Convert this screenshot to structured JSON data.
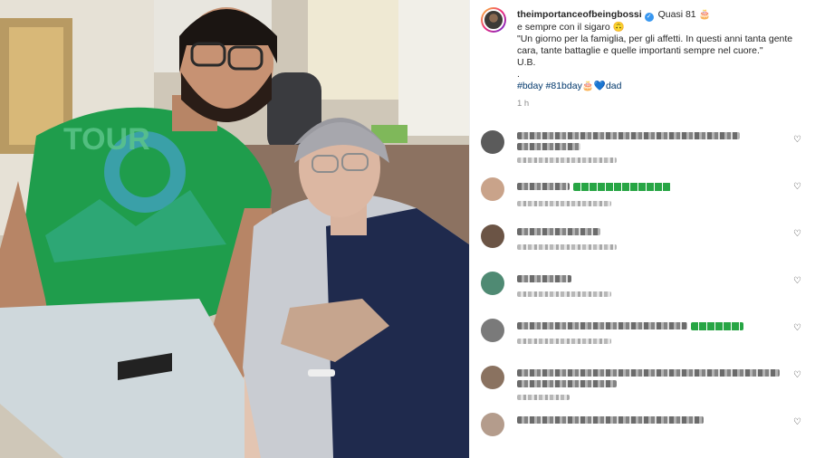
{
  "post": {
    "username": "theimportanceofbeingbossi",
    "verified_mark": "✓",
    "caption_first": "Quasi 81 🎂",
    "caption_line2": "e sempre con il sigaro 🙃",
    "caption_quote": "\"Un giorno per la famiglia, per gli affetti. In questi anni tanta gente cara, tante battaglie e quelle importanti sempre nel cuore.\"",
    "caption_sign": "U.B.",
    "caption_dot": ".",
    "hashtags": "#bday #81bday🎂💙dad",
    "time": "1 h"
  },
  "comments": [
    {
      "heart": "♡"
    },
    {
      "heart": "♡"
    },
    {
      "heart": "♡"
    },
    {
      "heart": "♡"
    },
    {
      "heart": "♡"
    },
    {
      "heart": "♡"
    },
    {
      "heart": "♡"
    }
  ],
  "colors": {
    "link": "#00376b",
    "verified": "#3897f0",
    "secondary_text": "#8e8e8e",
    "shirt_green": "#1f9d4c"
  },
  "icons": [
    "verified-icon",
    "heart-icon"
  ]
}
